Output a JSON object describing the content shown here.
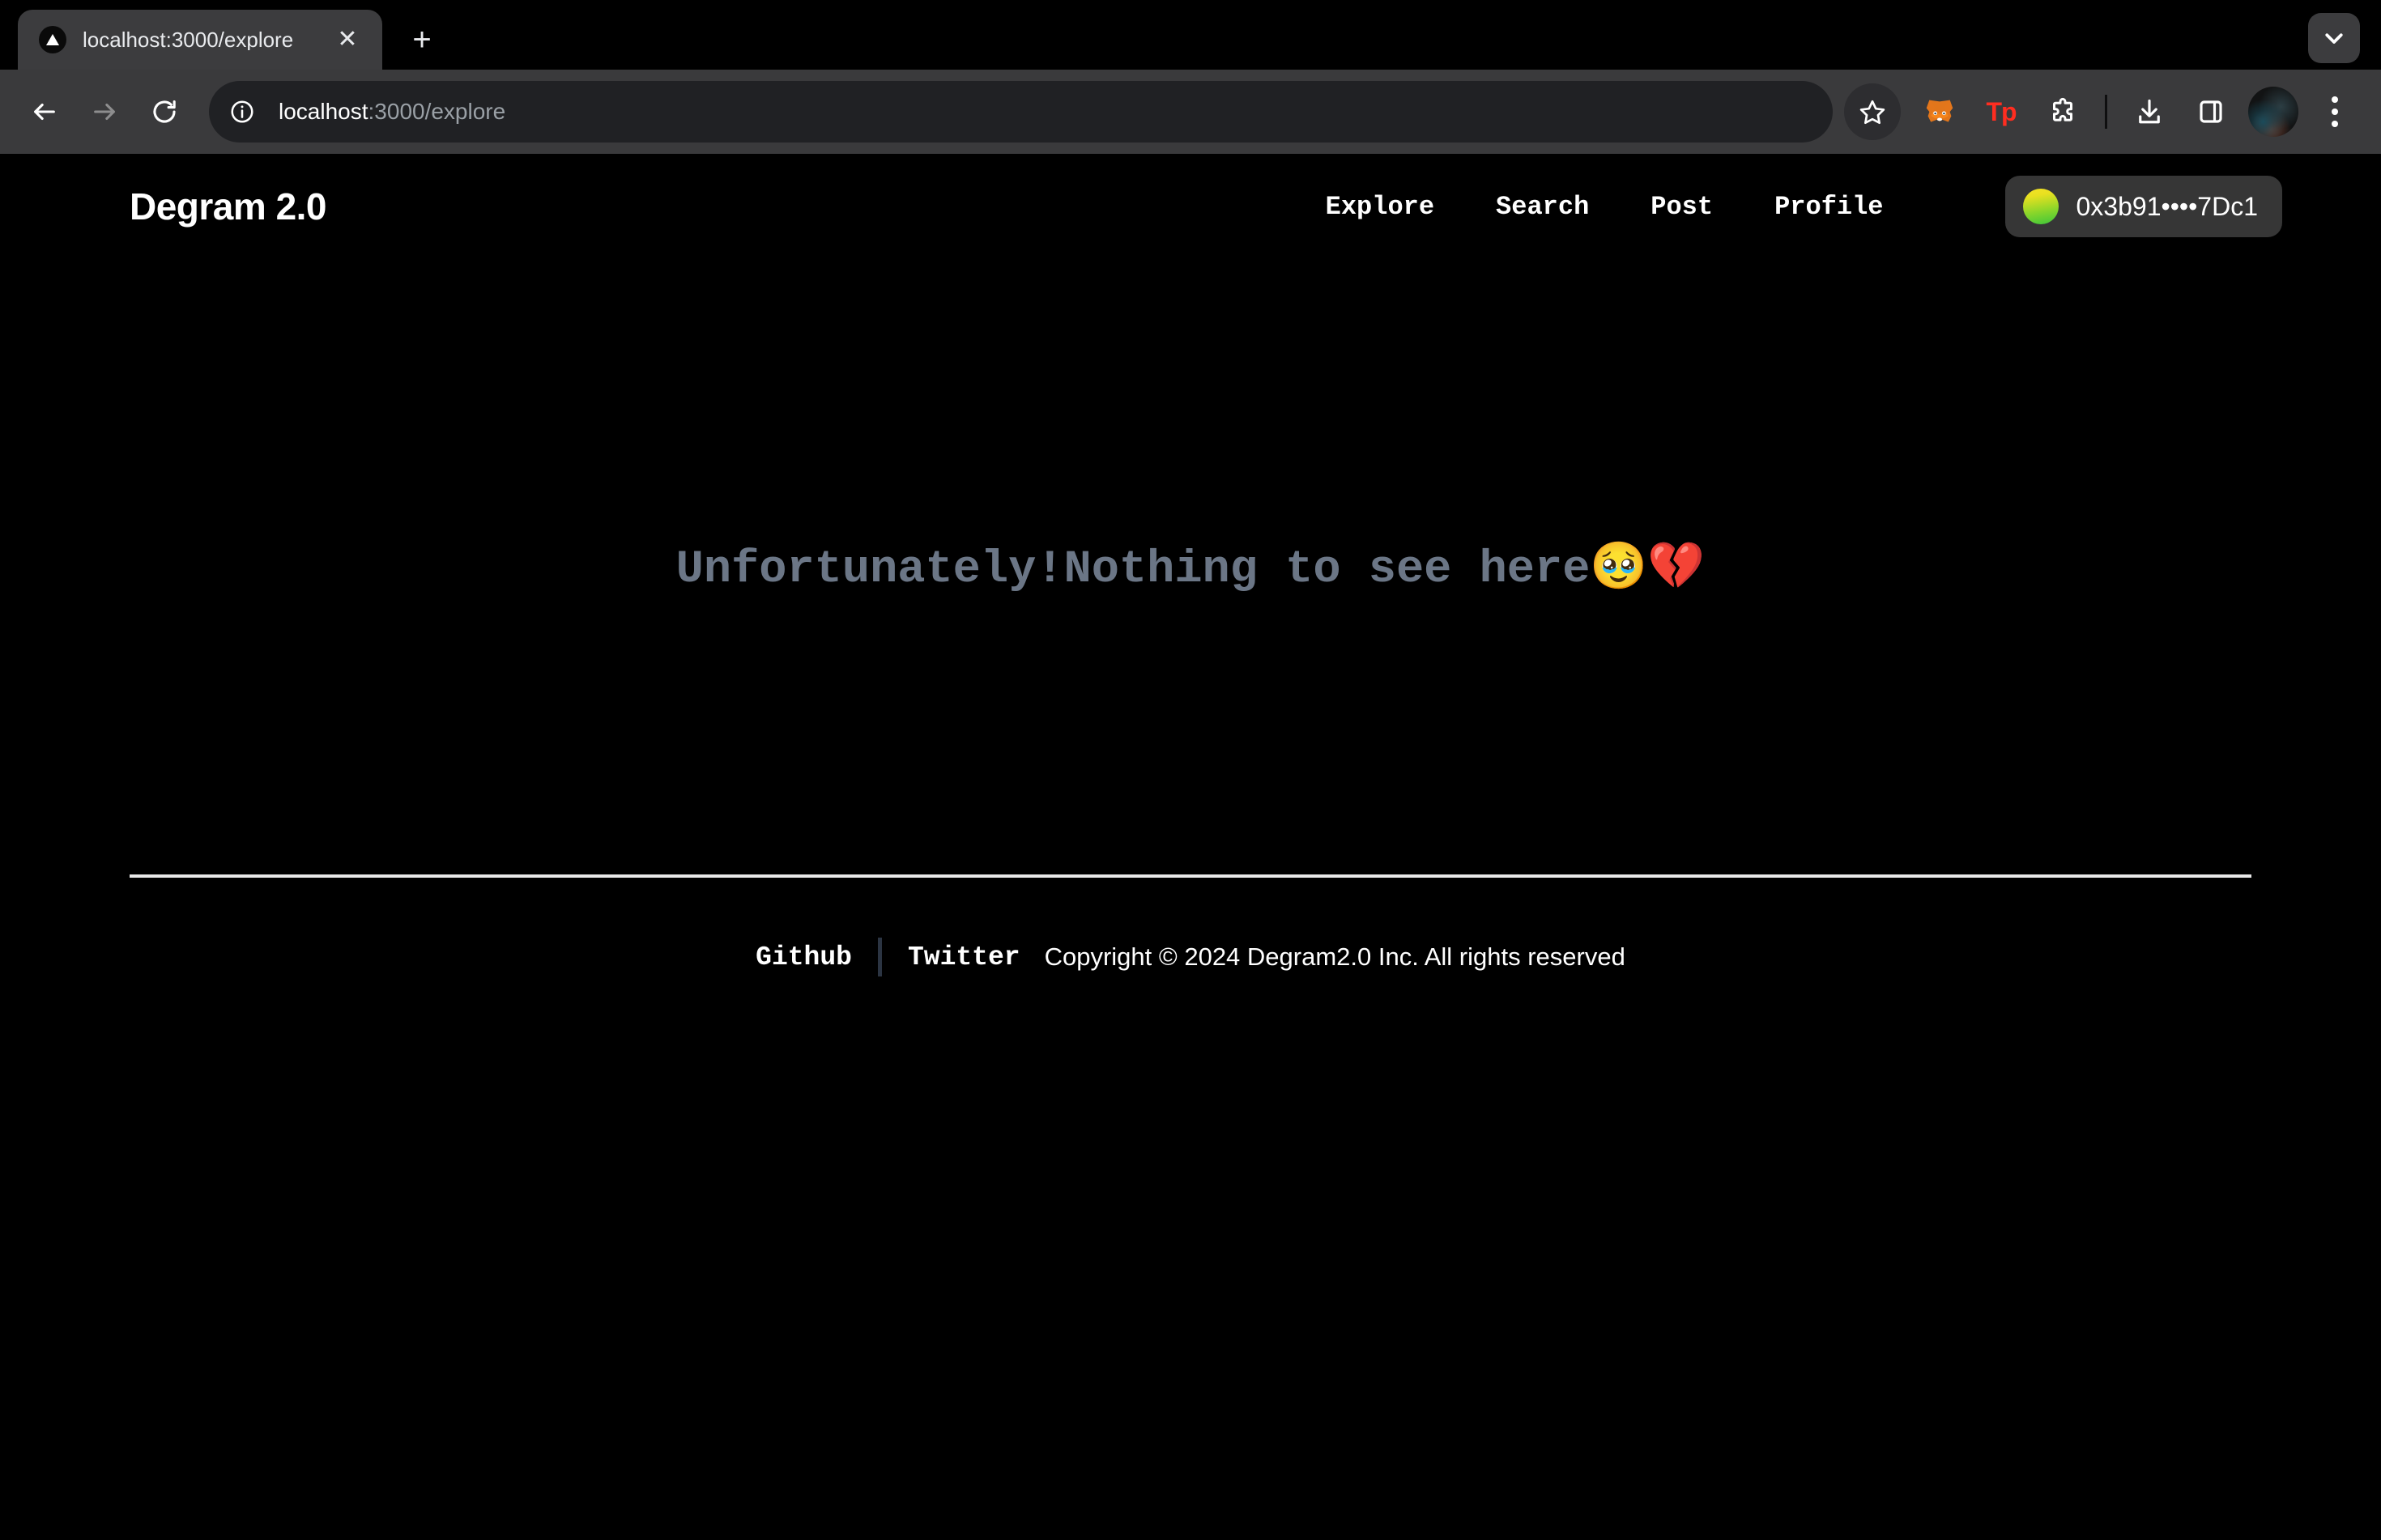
{
  "browser": {
    "tab": {
      "title": "localhost:3000/explore",
      "favicon_icon": "nextjs-triangle-icon",
      "close_icon": "close-icon"
    },
    "new_tab_label": "+",
    "tab_list_chevron_icon": "chevron-down-icon",
    "toolbar": {
      "back_icon": "arrow-left-icon",
      "forward_icon": "arrow-right-icon",
      "reload_icon": "reload-icon",
      "site_info_icon": "info-circle-icon",
      "url_host": "localhost",
      "url_path": ":3000/explore",
      "url_full": "localhost:3000/explore",
      "bookmark_icon": "star-icon",
      "extensions": [
        {
          "name": "metamask-icon",
          "label": ""
        },
        {
          "name": "tokenpocket-icon",
          "label": "Tp"
        },
        {
          "name": "puzzle-extensions-icon",
          "label": ""
        }
      ],
      "download_icon": "download-icon",
      "side_panel_icon": "side-panel-icon",
      "profile_icon": "profile-avatar",
      "menu_icon": "three-dot-menu-icon"
    }
  },
  "site": {
    "brand": "Degram 2.0",
    "nav": [
      {
        "label": "Explore"
      },
      {
        "label": "Search"
      },
      {
        "label": "Post"
      },
      {
        "label": "Profile"
      }
    ],
    "wallet": {
      "address": "0x3b91••••7Dc1",
      "avatar_icon": "wallet-gradient-avatar",
      "gradient_from": "#f5e327",
      "gradient_to": "#3bc63b"
    },
    "main": {
      "empty_text": "Unfortunately!Nothing to see here",
      "empty_emoji": "🥹💔",
      "text_color": "#6b7686"
    },
    "footer": {
      "github_label": "Github",
      "twitter_label": "Twitter",
      "copyright": "Copyright © 2024 Degram2.0 Inc. All rights reserved"
    },
    "background_color": "#000000"
  }
}
